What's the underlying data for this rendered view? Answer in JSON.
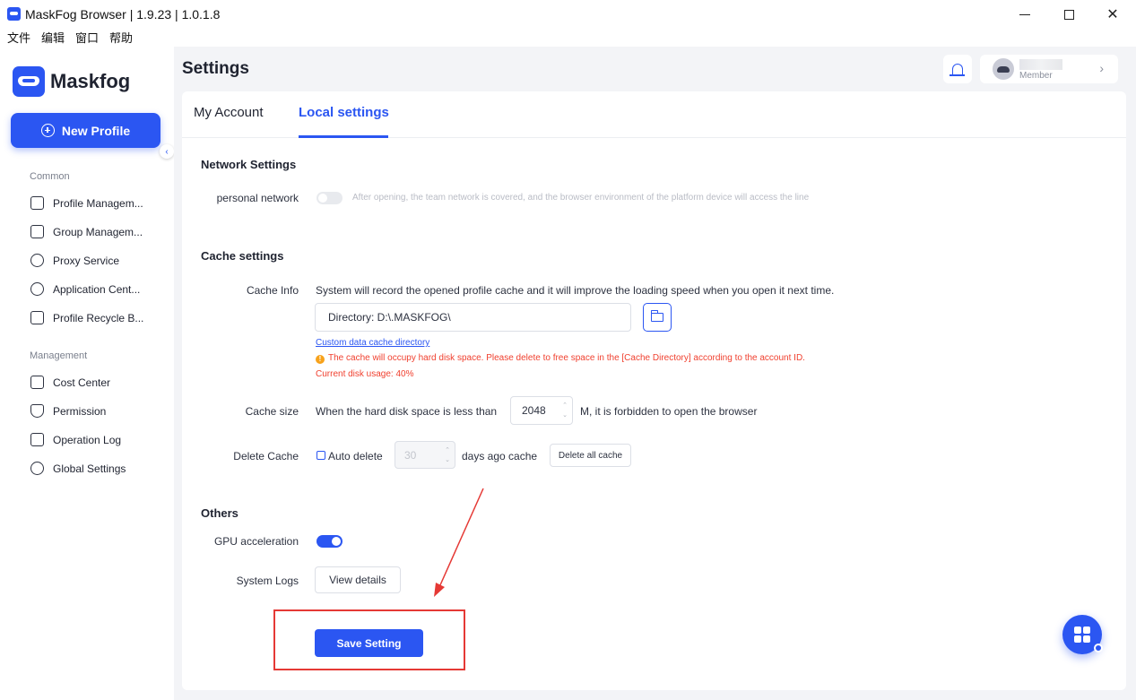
{
  "window": {
    "title": "MaskFog Browser | 1.9.23 | 1.0.1.8",
    "minimize_glyph": "—",
    "close_glyph": "✕"
  },
  "menubar": [
    "文件",
    "编辑",
    "窗口",
    "帮助"
  ],
  "sidebar": {
    "logo_text": "Maskfog",
    "new_profile_label": "New Profile",
    "collapse_glyph": "‹",
    "common_title": "Common",
    "common_items": [
      {
        "label": "Profile Managem...",
        "icon": "profile-list-icon"
      },
      {
        "label": "Group Managem...",
        "icon": "folder-icon"
      },
      {
        "label": "Proxy Service",
        "icon": "location-pin-icon"
      },
      {
        "label": "Application Cent...",
        "icon": "cube-icon"
      },
      {
        "label": "Profile Recycle B...",
        "icon": "trash-icon"
      }
    ],
    "management_title": "Management",
    "management_items": [
      {
        "label": "Cost Center",
        "icon": "dollar-icon"
      },
      {
        "label": "Permission",
        "icon": "shield-icon"
      },
      {
        "label": "Operation Log",
        "icon": "clipboard-icon"
      },
      {
        "label": "Global Settings",
        "icon": "settings-icon"
      }
    ]
  },
  "header": {
    "title": "Settings",
    "user_role": "Member",
    "chevron": "›"
  },
  "tabs": [
    {
      "label": "My Account",
      "active": false
    },
    {
      "label": "Local settings",
      "active": true
    }
  ],
  "network": {
    "section_title": "Network Settings",
    "personal_label": "personal network",
    "personal_enabled": false,
    "personal_desc": "After opening, the team network is covered, and the browser environment of the platform device will access the line"
  },
  "cache": {
    "section_title": "Cache settings",
    "info_label": "Cache Info",
    "info_text": "System will record the opened profile cache and it will improve the loading speed when you open it next time.",
    "directory_value": "Directory: D:\\.MASKFOG\\",
    "custom_link": "Custom data cache directory",
    "warning_icon": "!",
    "warning_text": "The cache will occupy hard disk space. Please delete to free space in the [Cache Directory] according to the account ID.",
    "disk_usage": "Current disk usage: 40%",
    "size_label": "Cache size",
    "size_prefix": "When the hard disk space is less than",
    "size_value": "2048",
    "size_suffix": "M, it is forbidden to open the browser",
    "spin_up": "⌃",
    "spin_down": "⌄",
    "delete_label": "Delete Cache",
    "auto_delete_label": "Auto delete",
    "auto_delete_checked": false,
    "auto_delete_days": "30",
    "days_suffix": "days ago cache",
    "delete_all_button": "Delete all cache"
  },
  "others": {
    "section_title": "Others",
    "gpu_label": "GPU acceleration",
    "gpu_enabled": true,
    "logs_label": "System Logs",
    "view_details_button": "View details"
  },
  "save_button": "Save Setting",
  "colors": {
    "accent": "#2b56f2",
    "warning": "#f0402f",
    "annotation": "#e53935"
  }
}
